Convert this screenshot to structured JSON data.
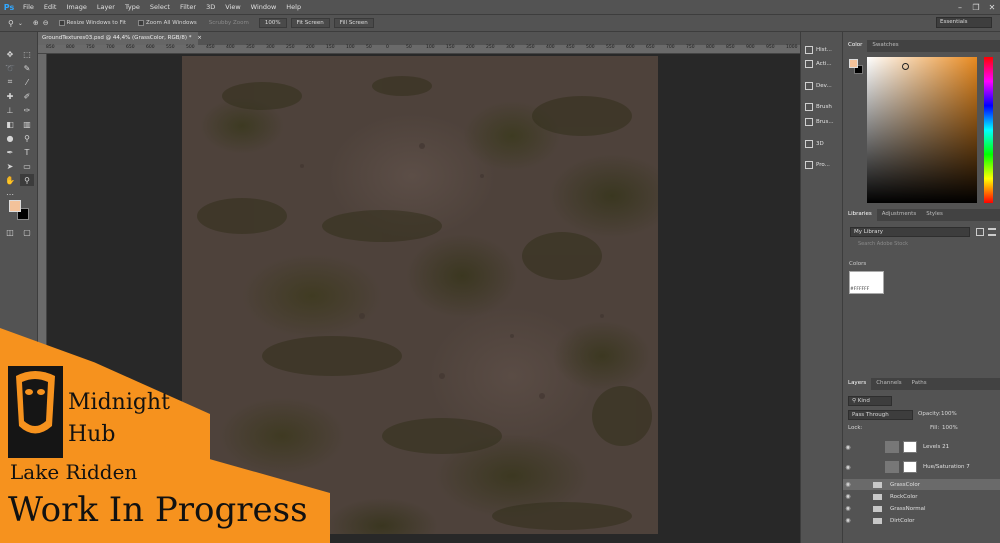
{
  "app": {
    "logo": "Ps"
  },
  "menu": [
    "File",
    "Edit",
    "Image",
    "Layer",
    "Type",
    "Select",
    "Filter",
    "3D",
    "View",
    "Window",
    "Help"
  ],
  "window_controls": [
    "–",
    "❐",
    "✕"
  ],
  "options": {
    "zoom_icon": "zoom-icon",
    "resize_windows": "Resize Windows to Fit",
    "zoom_all": "Zoom All Windows",
    "scrubby": "Scrubby Zoom",
    "zoom_value": "100%",
    "fit_screen": "Fit Screen",
    "fill_screen": "Fill Screen",
    "workspace": "Essentials"
  },
  "document": {
    "tab": "GroundTextures03.psd @ 44,4% (GrassColor, RGB/8) *",
    "ruler_top": [
      "850",
      "800",
      "750",
      "700",
      "650",
      "600",
      "550",
      "500",
      "450",
      "400",
      "350",
      "300",
      "250",
      "200",
      "150",
      "100",
      "50",
      "0",
      "50",
      "100",
      "150",
      "200",
      "250",
      "300",
      "350",
      "400",
      "450",
      "500",
      "550",
      "600",
      "650",
      "700",
      "750",
      "800",
      "850",
      "900",
      "950",
      "1000"
    ]
  },
  "icon_strip": [
    "Hist...",
    "Acti...",
    "Dev...",
    "Brush",
    "Brus...",
    "3D",
    "Pro..."
  ],
  "color_panel": {
    "tabs": [
      "Color",
      "Swatches"
    ],
    "fg": "#f3c29a",
    "bg": "#000000"
  },
  "libraries": {
    "tabs": [
      "Libraries",
      "Adjustments",
      "Styles"
    ],
    "library": "My Library",
    "search": "Search Adobe Stock",
    "colors_header": "Colors",
    "color_hex": "#FFFFFF"
  },
  "layers": {
    "tabs": [
      "Layers",
      "Channels",
      "Paths"
    ],
    "kind": "Kind",
    "blend": "Pass Through",
    "opacity_label": "Opacity:",
    "opacity": "100%",
    "lock_label": "Lock:",
    "fill_label": "Fill:",
    "fill": "100%",
    "items": [
      {
        "name": "Levels 21",
        "type": "adjustment"
      },
      {
        "name": "Hue/Saturation 7",
        "type": "adjustment"
      },
      {
        "name": "GrassColor",
        "type": "group",
        "selected": true
      },
      {
        "name": "RockColor",
        "type": "group"
      },
      {
        "name": "GrassNormal",
        "type": "group"
      },
      {
        "name": "DirtColor",
        "type": "group"
      }
    ]
  },
  "overlay": {
    "brand_line1": "Midnight",
    "brand_line2": "Hub",
    "project": "Lake Ridden",
    "status": "Work In Progress"
  }
}
